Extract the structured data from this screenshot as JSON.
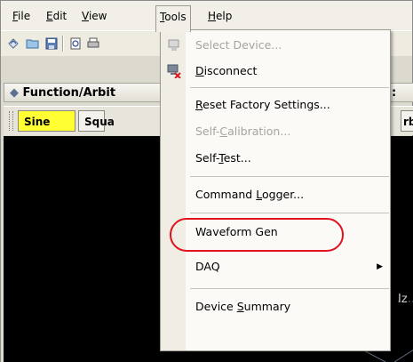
{
  "menubar": {
    "items": [
      {
        "label": "File",
        "underline": "F"
      },
      {
        "label": "Edit",
        "underline": "E"
      },
      {
        "label": "View",
        "underline": "V"
      },
      {
        "label": "Tools",
        "underline": "T"
      },
      {
        "label": "Help",
        "underline": "H"
      }
    ],
    "active": "Tools"
  },
  "panel": {
    "title": "Function/Arbit",
    "title_right": ":"
  },
  "waveform_bar": {
    "sine": "Sine",
    "square": "Squa",
    "arb": "rb"
  },
  "display": {
    "unit_fragment": "Iz"
  },
  "tools_menu": {
    "items": [
      {
        "label": "Select Device...",
        "disabled": true,
        "icon": "select-device-icon"
      },
      {
        "label": "Disconnect",
        "disabled": false,
        "icon": "disconnect-icon"
      },
      {
        "label": "Reset Factory Settings...",
        "disabled": false
      },
      {
        "label": "Self-Calibration...",
        "disabled": true
      },
      {
        "label": "Self-Test...",
        "disabled": false
      },
      {
        "label": "Command Logger...",
        "disabled": false
      },
      {
        "label": "Waveform Gen",
        "disabled": false
      },
      {
        "label": "DAQ",
        "disabled": false,
        "submenu": true
      },
      {
        "label": "Device Summary",
        "disabled": false
      }
    ]
  },
  "colors": {
    "highlight_ring": "#e0121c",
    "sine_button": "#ffff33",
    "display_bg": "#000000"
  }
}
